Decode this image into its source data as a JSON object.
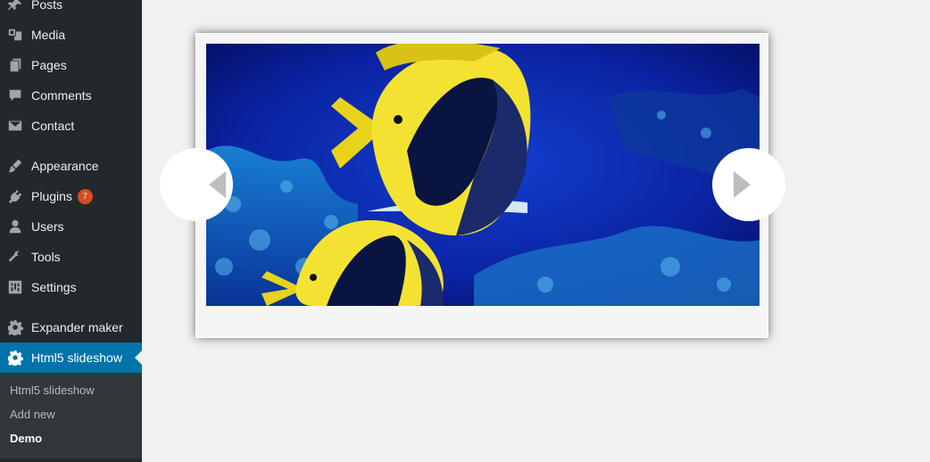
{
  "sidebar": {
    "items": [
      {
        "name": "menu-posts",
        "icon": "pin-icon",
        "label": "Posts"
      },
      {
        "name": "menu-media",
        "icon": "media-icon",
        "label": "Media"
      },
      {
        "name": "menu-pages",
        "icon": "pages-icon",
        "label": "Pages"
      },
      {
        "name": "menu-comments",
        "icon": "comment-icon",
        "label": "Comments"
      },
      {
        "name": "menu-contact",
        "icon": "mail-icon",
        "label": "Contact"
      },
      {
        "name": "menu-appearance",
        "icon": "brush-icon",
        "label": "Appearance"
      },
      {
        "name": "menu-plugins",
        "icon": "plug-icon",
        "label": "Plugins",
        "badge": "7"
      },
      {
        "name": "menu-users",
        "icon": "user-icon",
        "label": "Users"
      },
      {
        "name": "menu-tools",
        "icon": "wrench-icon",
        "label": "Tools"
      },
      {
        "name": "menu-settings",
        "icon": "settings-icon",
        "label": "Settings"
      },
      {
        "name": "menu-expander-maker",
        "icon": "gear-icon",
        "label": "Expander maker"
      },
      {
        "name": "menu-html5-slideshow",
        "icon": "gear-icon",
        "label": "Html5 slideshow",
        "active": true
      }
    ],
    "submenu": [
      {
        "label": "Html5 slideshow"
      },
      {
        "label": "Add new"
      },
      {
        "label": "Demo",
        "current": true
      }
    ]
  },
  "slideshow": {
    "image_subject": "bannerfish-underwater",
    "prev_icon": "triangle-left-icon",
    "next_icon": "triangle-right-icon"
  },
  "colors": {
    "sidebar_bg": "#23282d",
    "active_bg": "#0073aa",
    "badge_bg": "#d54e21",
    "page_bg": "#f1f1f1"
  }
}
